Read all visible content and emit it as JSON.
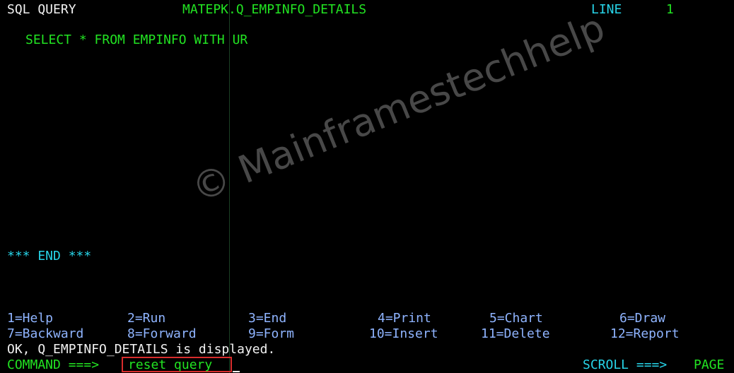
{
  "header": {
    "panel": "SQL QUERY",
    "query_name": "MATEPK.Q_EMPINFO_DETAILS",
    "line_label": "LINE",
    "line_number": "1"
  },
  "query": {
    "text": "SELECT * FROM EMPINFO WITH UR"
  },
  "end_marker": "*** END ***",
  "function_keys": [
    "1=Help",
    "2=Run",
    "3=End",
    "4=Print",
    "5=Chart",
    "6=Draw",
    "7=Backward",
    "8=Forward",
    "9=Form",
    "10=Insert",
    "11=Delete",
    "12=Report"
  ],
  "message": "OK, Q_EMPINFO_DETAILS is displayed.",
  "command": {
    "label": "COMMAND ===>",
    "value": "reset query"
  },
  "scroll": {
    "label": "SCROLL ===>",
    "value": "PAGE"
  },
  "watermark": "© Mainframestechhelp",
  "colors": {
    "background": "#000000",
    "green": "#22e322",
    "cyan": "#27d4e8",
    "blue": "#8fb4ff",
    "white": "#f2f2f2",
    "highlight": "#d82c2c"
  }
}
